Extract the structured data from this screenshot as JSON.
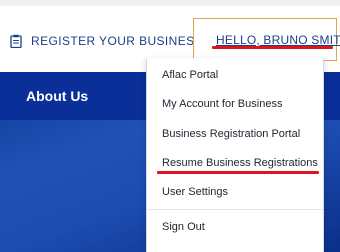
{
  "header": {
    "register_label": "REGISTER YOUR BUSINESS",
    "user_greeting": "HELLO, BRUNO SMITH"
  },
  "nav": {
    "about_label": "About Us"
  },
  "menu": {
    "items": [
      {
        "label": "Aflac Portal"
      },
      {
        "label": "My Account for Business"
      },
      {
        "label": "Business Registration Portal"
      },
      {
        "label": "Resume Business Registrations"
      },
      {
        "label": "User Settings"
      },
      {
        "label": "Sign Out"
      }
    ]
  },
  "colors": {
    "brand_blue": "#1c3f8c",
    "nav_blue": "#0a2f98",
    "highlight_red": "#e0141e",
    "box_border_orange": "#e7a24b"
  },
  "icons": {
    "register": "clipboard-icon"
  }
}
